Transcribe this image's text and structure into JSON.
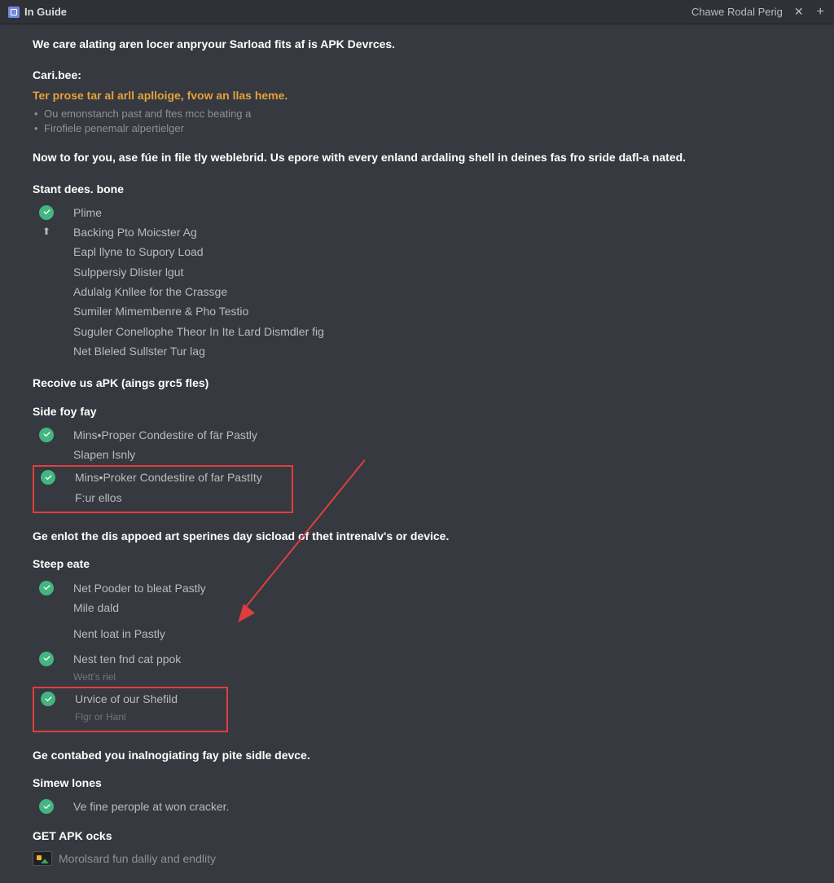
{
  "titlebar": {
    "title": "In Guide",
    "right_text": "Chawe Rodal Perig"
  },
  "intro": "We care alating aren locer anpryour Sarload fits af is APK Devrces.",
  "caribee": {
    "label": "Cari.bee:",
    "orange": "Ter prose tar al arll aplloige, fvow an llas heme.",
    "bullets": [
      "Ou emonstanch past and ftes mcc beating a",
      "Firofiele penemalr alpertielger"
    ]
  },
  "paragraph": "Now to for you, ase fúe in file tly weblebrid. Us epore with every enland ardaling shell in deines fas fro sride dafl-a nated.",
  "section1": {
    "title": "Stant dees. bone",
    "items": [
      "Plime",
      "Backing Pto Moicster Ag",
      "Eapl llyne to Supory Load",
      "Sulppersiy Dlister lgut",
      "Adulalg Knllee for the Crassge",
      "Sumiler Mimembenre & Pho Testio",
      "Suguler Conellophe Theor In Ite Lard Dismdler fig",
      "Net Bleled Sullster Tur lag"
    ]
  },
  "section2": {
    "title": "Recoive us aPK (aings grc5 fles)"
  },
  "section3": {
    "title": "Side foy fay",
    "item1": "Mins•Proper Condestire of fär Pastly",
    "item1b": "Slapen  Isnly",
    "box_line1": "Mins•Proker Condestire of far PastIty",
    "box_line2": "F:ur ellos"
  },
  "mid_paragraph": "Ge enlot the dis appoed art sperines day sicload of thet intrenalv's or device.",
  "section4": {
    "title": "Steep eate",
    "item1": "Net Pooder to bleat Pastly",
    "item1b": "Mile dald",
    "item2": "Nent loat in Pastly",
    "item3": "Nest ten fnd cat ppok",
    "item3b": "Wett's  riel",
    "box_line1": "Urvice of our Shefild",
    "box_line2": "Flgr or Hanl"
  },
  "mid_paragraph2": "Ge contabed you inalnogiating fay pite sidle devce.",
  "section5": {
    "title": "Simew lones",
    "item1": "Ve fine perople at won cracker."
  },
  "get_apk": {
    "title": "GET APK ocks",
    "sub": "Morolsard fun dalliy and endlity"
  }
}
